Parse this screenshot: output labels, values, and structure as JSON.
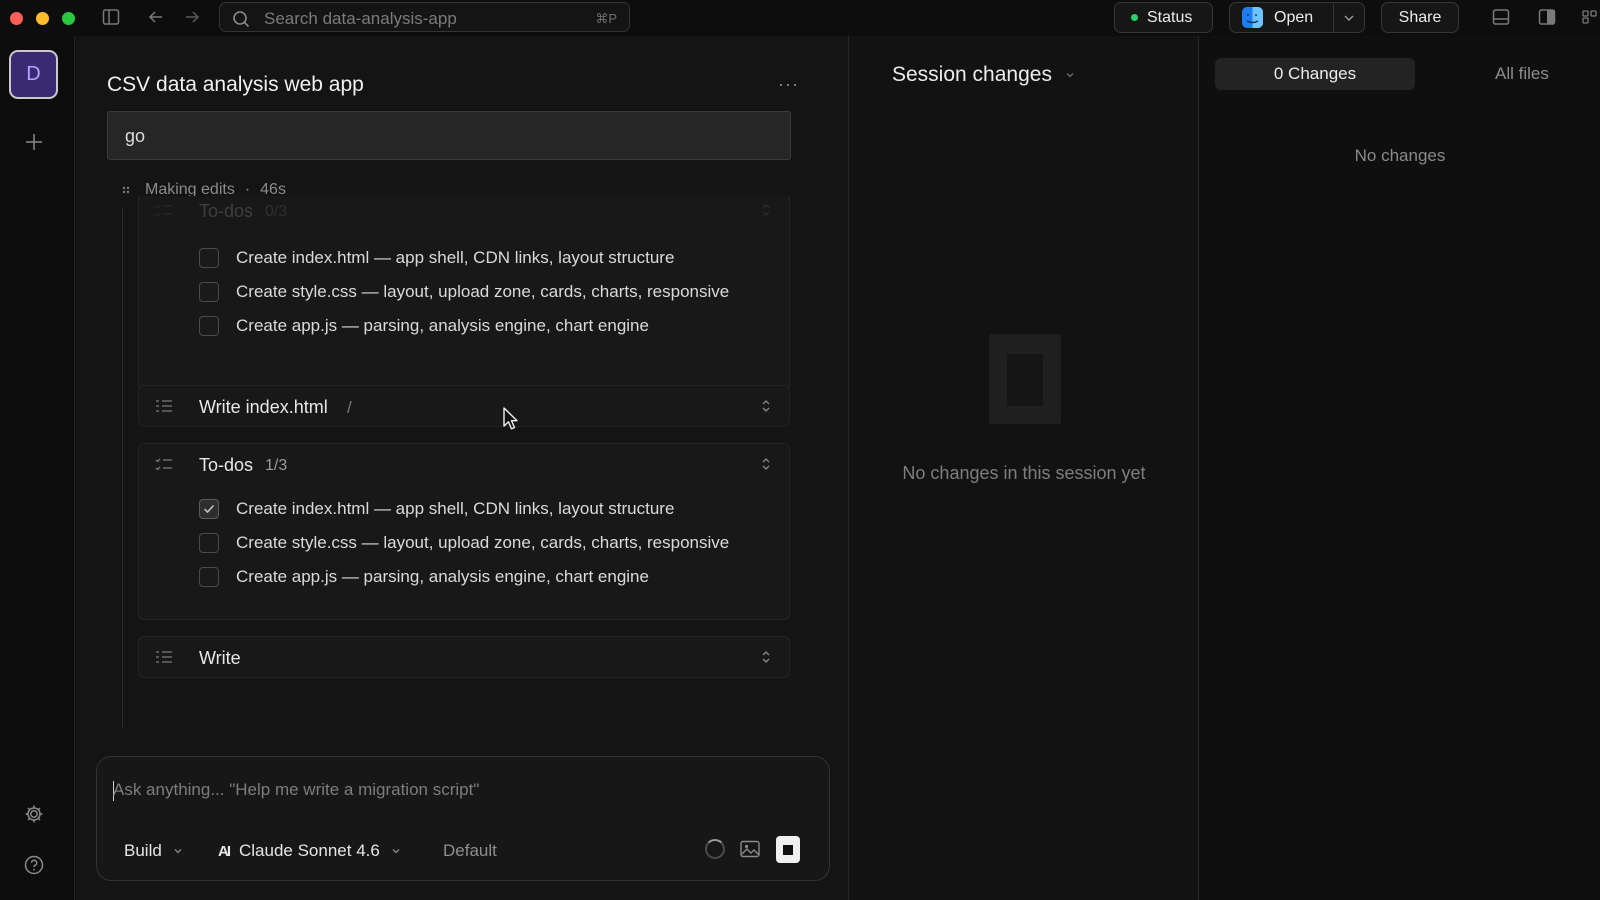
{
  "titlebar": {
    "search_placeholder": "Search data-analysis-app",
    "search_shortcut": "⌘P",
    "status_label": "Status",
    "open_label": "Open",
    "share_label": "Share"
  },
  "rail": {
    "avatar_letter": "D"
  },
  "chat": {
    "title": "CSV data analysis web app",
    "more": "···",
    "prompt": "go",
    "activity": {
      "label": "Making edits",
      "separator": "·",
      "duration": "46s"
    },
    "cards": [
      {
        "title": "To-dos",
        "count": "0/3",
        "items": [
          {
            "text": "Create index.html — app shell, CDN links, layout structure",
            "checked": false
          },
          {
            "text": "Create style.css — layout, upload zone, cards, charts, responsive",
            "checked": false
          },
          {
            "text": "Create app.js — parsing, analysis engine, chart engine",
            "checked": false
          }
        ]
      },
      {
        "title": "Write index.html",
        "suffix": "/"
      },
      {
        "title": "To-dos",
        "count": "1/3",
        "items": [
          {
            "text": "Create index.html — app shell, CDN links, layout structure",
            "checked": true
          },
          {
            "text": "Create style.css — layout, upload zone, cards, charts, responsive",
            "checked": false
          },
          {
            "text": "Create app.js — parsing, analysis engine, chart engine",
            "checked": false
          }
        ]
      },
      {
        "title": "Write"
      }
    ]
  },
  "composer": {
    "placeholder": "Ask anything... \"Help me write a migration script\"",
    "mode": "Build",
    "model_icon": "AI",
    "model": "Claude Sonnet 4.6",
    "variant": "Default"
  },
  "session": {
    "title": "Session changes",
    "empty_text": "No changes in this session yet"
  },
  "changes": {
    "active_tab": "0 Changes",
    "other_tab": "All files",
    "empty_text": "No changes"
  },
  "colors": {
    "status_dot": "#2ad46a",
    "avatar_bg": "#3a2a74",
    "avatar_fg": "#b6a2ff"
  }
}
